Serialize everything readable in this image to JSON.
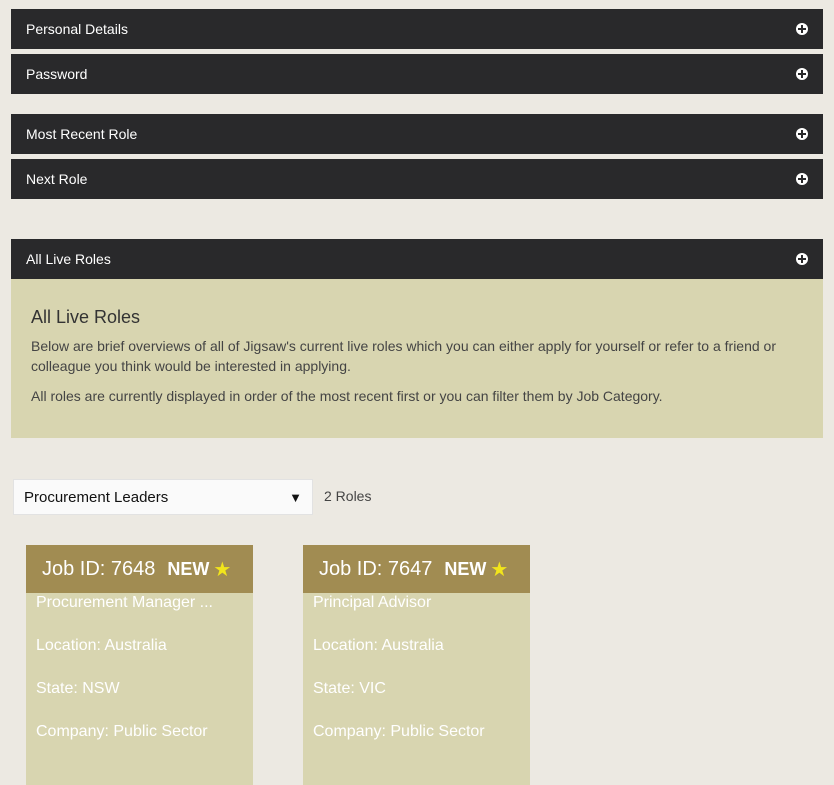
{
  "sections": [
    {
      "title": "Personal Details"
    },
    {
      "title": "Password"
    },
    {
      "title": "Most Recent Role"
    },
    {
      "title": "Next Role"
    },
    {
      "title": "All Live Roles"
    }
  ],
  "live_roles": {
    "heading": "All Live Roles",
    "paragraph1": "Below are brief overviews of all of Jigsaw's current live roles which you can either apply for yourself or refer to a friend or colleague you think would be interested in applying.",
    "paragraph2": "All roles are currently displayed in order of the most recent first or you can filter them by Job Category."
  },
  "filter": {
    "selected": "Procurement Leaders",
    "count_label": "2 Roles"
  },
  "jobs": [
    {
      "id_label": "Job ID: 7648",
      "badge": "NEW",
      "title": "Procurement Manager ...",
      "location": "Location: Australia",
      "state": "State: NSW",
      "company": "Company: Public Sector"
    },
    {
      "id_label": "Job ID: 7647",
      "badge": "NEW",
      "title": "Principal Advisor",
      "location": "Location: Australia",
      "state": "State: VIC",
      "company": "Company: Public Sector"
    }
  ],
  "colors": {
    "accordion_bg": "#29292b",
    "panel_bg": "#d8d5b0",
    "card_header_bg": "#a18c52",
    "star": "#f2e51b"
  },
  "icons": {
    "expand": "plus-circle-icon",
    "dropdown": "caret-down-icon",
    "badge": "star-icon"
  }
}
